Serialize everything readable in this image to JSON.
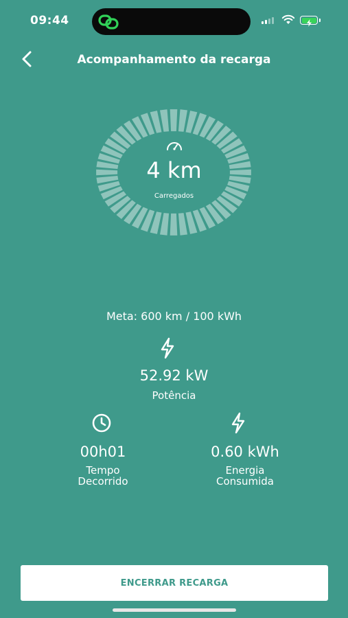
{
  "status_bar": {
    "time": "09:44",
    "battery_color": "#39d35a"
  },
  "header": {
    "title": "Acompanhamento da recarga",
    "back_icon": "chevron-left-icon"
  },
  "gauge": {
    "icon": "speedometer-icon",
    "value": "4 km",
    "label": "Carregados",
    "progress_fraction": 0.007
  },
  "goal": {
    "text": "Meta: 600 km / 100 kWh"
  },
  "power": {
    "icon": "lightning-icon",
    "value": "52.92 kW",
    "label": "Potência"
  },
  "elapsed": {
    "icon": "clock-icon",
    "value": "00h01",
    "label_line1": "Tempo",
    "label_line2": "Decorrido"
  },
  "energy": {
    "icon": "lightning-icon",
    "value": "0.60 kWh",
    "label_line1": "Energia",
    "label_line2": "Consumida"
  },
  "actions": {
    "end_label": "ENCERRAR RECARGA"
  },
  "colors": {
    "background": "#3f9a8b",
    "accent_text": "#3f9a8b",
    "button_bg": "#ffffff"
  }
}
